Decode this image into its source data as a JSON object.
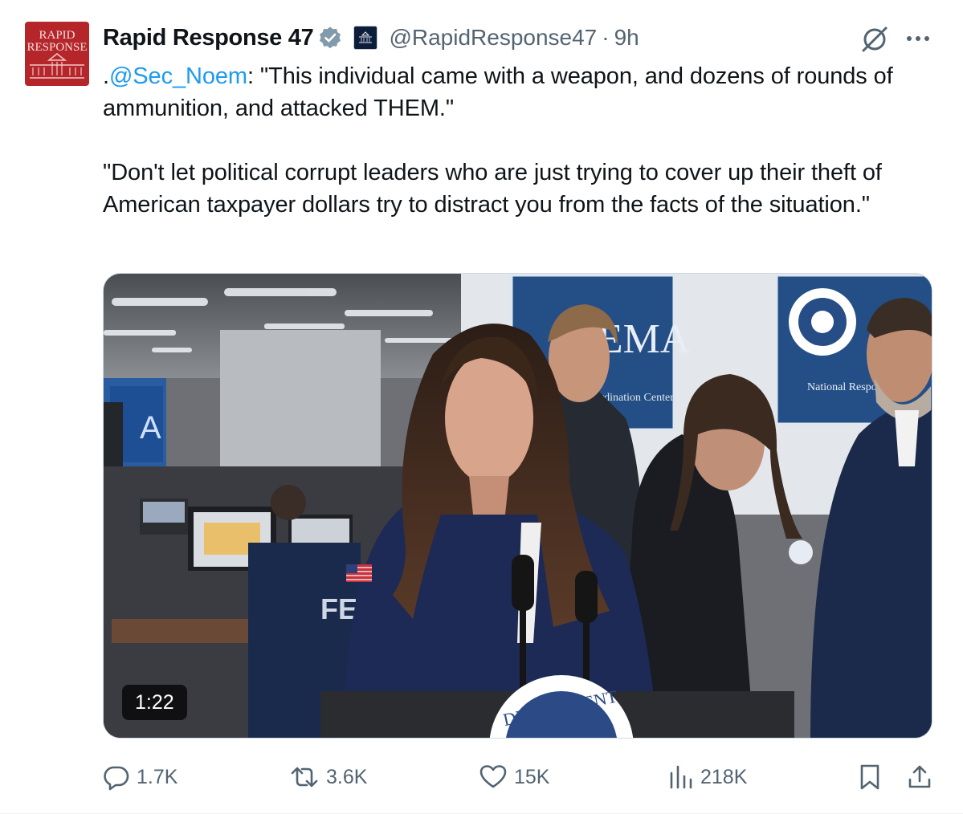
{
  "account": {
    "display_name": "Rapid Response 47",
    "handle": "@RapidResponse47",
    "separator": "·",
    "time": "9h",
    "avatar_line1": "RAPID",
    "avatar_line2": "RESPONSE",
    "avatar_color": "#b5262b",
    "verified_color": "#829aab"
  },
  "tweet": {
    "mention": "@Sec_Noem",
    "line1_prefix": ".",
    "line1_rest": ": \"This individual came with a weapon, and dozens of rounds of ammunition, and attacked THEM.\"",
    "paragraph2": "\"Don't let political corrupt leaders who are just trying to cover up their theft of American taxpayer dollars try to distract you from the facts of the situation.\"",
    "mention_color": "#1d9bf0"
  },
  "media": {
    "duration": "1:22",
    "sign_fema": "FEMA",
    "sign_fema_sub": "nse Coordination Center",
    "sign_dhs_sub": "National Response C",
    "jacket_text": "FE",
    "seal_text": "DEPARTMENT"
  },
  "actions": {
    "replies": "1.7K",
    "reposts": "3.6K",
    "likes": "15K",
    "views": "218K",
    "icons": [
      "reply-icon",
      "repost-icon",
      "like-icon",
      "views-icon",
      "bookmark-icon",
      "share-icon"
    ]
  }
}
